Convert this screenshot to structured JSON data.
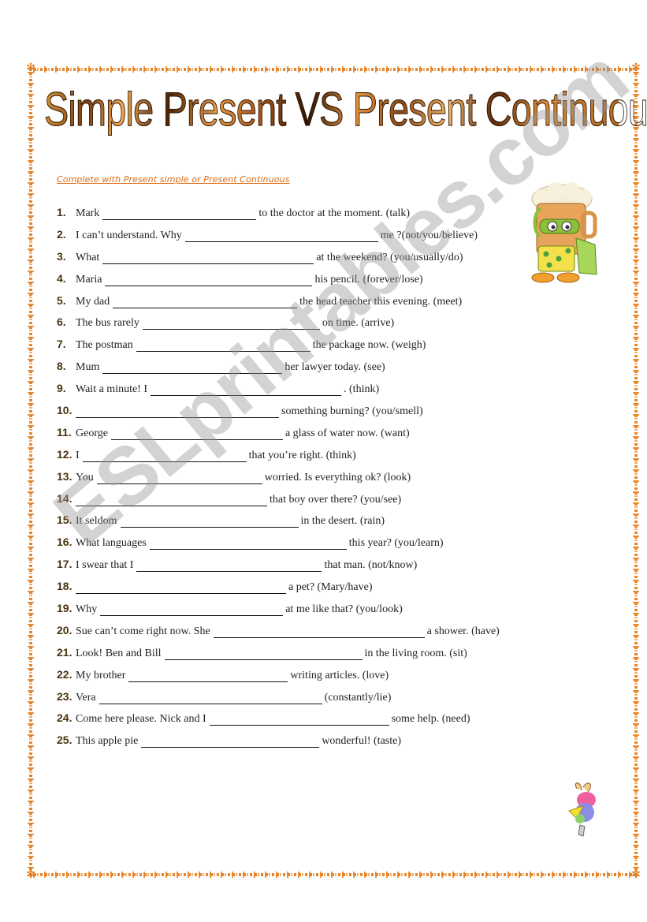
{
  "worksheet": {
    "title": "Simple Present VS Present Continuous",
    "instruction": "Complete with Present simple or Present Continuous",
    "watermark": "ESLprintables.com",
    "colors": {
      "border": "#e9862a",
      "instruction": "#e06a10",
      "numbers": "#4a3310",
      "title_gradient": [
        "#d79a3a",
        "#4a2408",
        "#e2913f",
        "#301404"
      ]
    },
    "clipart": [
      {
        "name": "beer-mug-snorkel-mascot",
        "label": "beer mug cartoon with snorkel and flippers"
      },
      {
        "name": "cartoon-bird",
        "label": "colourful cartoon bird"
      }
    ],
    "items": [
      {
        "num": "1.",
        "before": "Mark",
        "after": "to the doctor at the moment. (talk)"
      },
      {
        "num": "2.",
        "before": "I can’t understand. Why",
        "after": "me ?(not/you/believe)"
      },
      {
        "num": "3.",
        "before": "What",
        "after": "at the weekend? (you/usually/do)"
      },
      {
        "num": "4.",
        "before": "Maria",
        "after": "his pencil. (forever/lose)"
      },
      {
        "num": "5.",
        "before": "My dad",
        "after": "the head teacher this evening. (meet)"
      },
      {
        "num": "6.",
        "before": "The bus rarely",
        "after": "on time. (arrive)"
      },
      {
        "num": "7.",
        "before": "The postman",
        "after": "the package now. (weigh)"
      },
      {
        "num": "8.",
        "before": "Mum",
        "after": "her lawyer today. (see)"
      },
      {
        "num": "9.",
        "before": "Wait a minute! I",
        "after": ". (think)"
      },
      {
        "num": "10.",
        "before": "",
        "after": "something burning? (you/smell)"
      },
      {
        "num": "11.",
        "before": "George",
        "after": "a glass of water now. (want)"
      },
      {
        "num": "12.",
        "before": "I",
        "after": "that you’re right. (think)"
      },
      {
        "num": "13.",
        "before": "You",
        "after": "worried. Is everything ok? (look)"
      },
      {
        "num": "14.",
        "before": "",
        "after": "that boy over there? (you/see)"
      },
      {
        "num": "15.",
        "before": "It seldom",
        "after": "in the desert. (rain)"
      },
      {
        "num": "16.",
        "before": "What languages",
        "after": "this year? (you/learn)"
      },
      {
        "num": "17.",
        "before": "I swear that I",
        "after": "that man. (not/know)"
      },
      {
        "num": "18.",
        "before": "",
        "after": "a pet? (Mary/have)"
      },
      {
        "num": "19.",
        "before": "Why",
        "after": "at me like that? (you/look)"
      },
      {
        "num": "20.",
        "before": "Sue can’t come right now. She",
        "after": "a shower. (have)"
      },
      {
        "num": "21.",
        "before": "Look! Ben and Bill",
        "after": "in the living room. (sit)"
      },
      {
        "num": "22.",
        "before": "My brother",
        "after": "writing articles. (love)"
      },
      {
        "num": "23.",
        "before": "Vera",
        "after": "(constantly/lie)"
      },
      {
        "num": "24.",
        "before": "Come here please. Nick and I",
        "after": "some help. (need)"
      },
      {
        "num": "25.",
        "before": "This apple pie",
        "after": "wonderful! (taste)"
      }
    ]
  }
}
